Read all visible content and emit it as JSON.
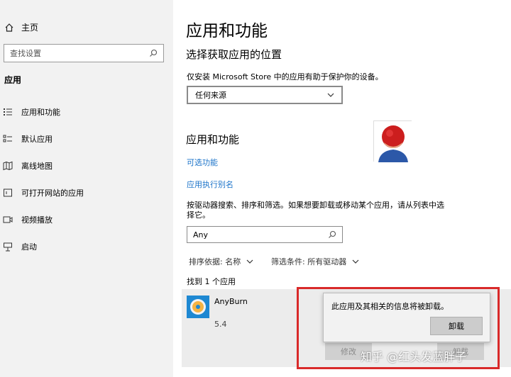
{
  "sidebar": {
    "home_label": "主页",
    "search_placeholder": "查找设置",
    "section_title": "应用",
    "items": [
      {
        "label": "应用和功能",
        "icon": "list-icon"
      },
      {
        "label": "默认应用",
        "icon": "default-apps-icon"
      },
      {
        "label": "离线地图",
        "icon": "map-icon"
      },
      {
        "label": "可打开网站的应用",
        "icon": "web-app-icon"
      },
      {
        "label": "视频播放",
        "icon": "video-icon"
      },
      {
        "label": "启动",
        "icon": "startup-icon"
      }
    ]
  },
  "main": {
    "title": "应用和功能",
    "choose_source_heading": "选择获取应用的位置",
    "choose_source_desc": "仅安装 Microsoft Store 中的应用有助于保护你的设备。",
    "source_select_value": "任何来源",
    "apps_heading": "应用和功能",
    "optional_features_link": "可选功能",
    "app_alias_link": "应用执行别名",
    "search_desc": "按驱动器搜索、排序和筛选。如果想要卸载或移动某个应用，请从列表中选择它。",
    "search_value": "Any",
    "sort_label": "排序依据: 名称",
    "filter_label": "筛选条件: 所有驱动器",
    "found_text": "找到 1 个应用",
    "app": {
      "name": "AnyBurn",
      "version": "5.4",
      "modify_label": "修改",
      "uninstall_label": "卸载"
    }
  },
  "popup": {
    "message": "此应用及其相关的信息将被卸载。",
    "button_label": "卸载"
  },
  "watermark": "知乎 @红头发蓝胖子",
  "colors": {
    "link": "#1b73c9",
    "highlight": "#d92a2a",
    "sidebar_bg": "#f2f2f2"
  }
}
